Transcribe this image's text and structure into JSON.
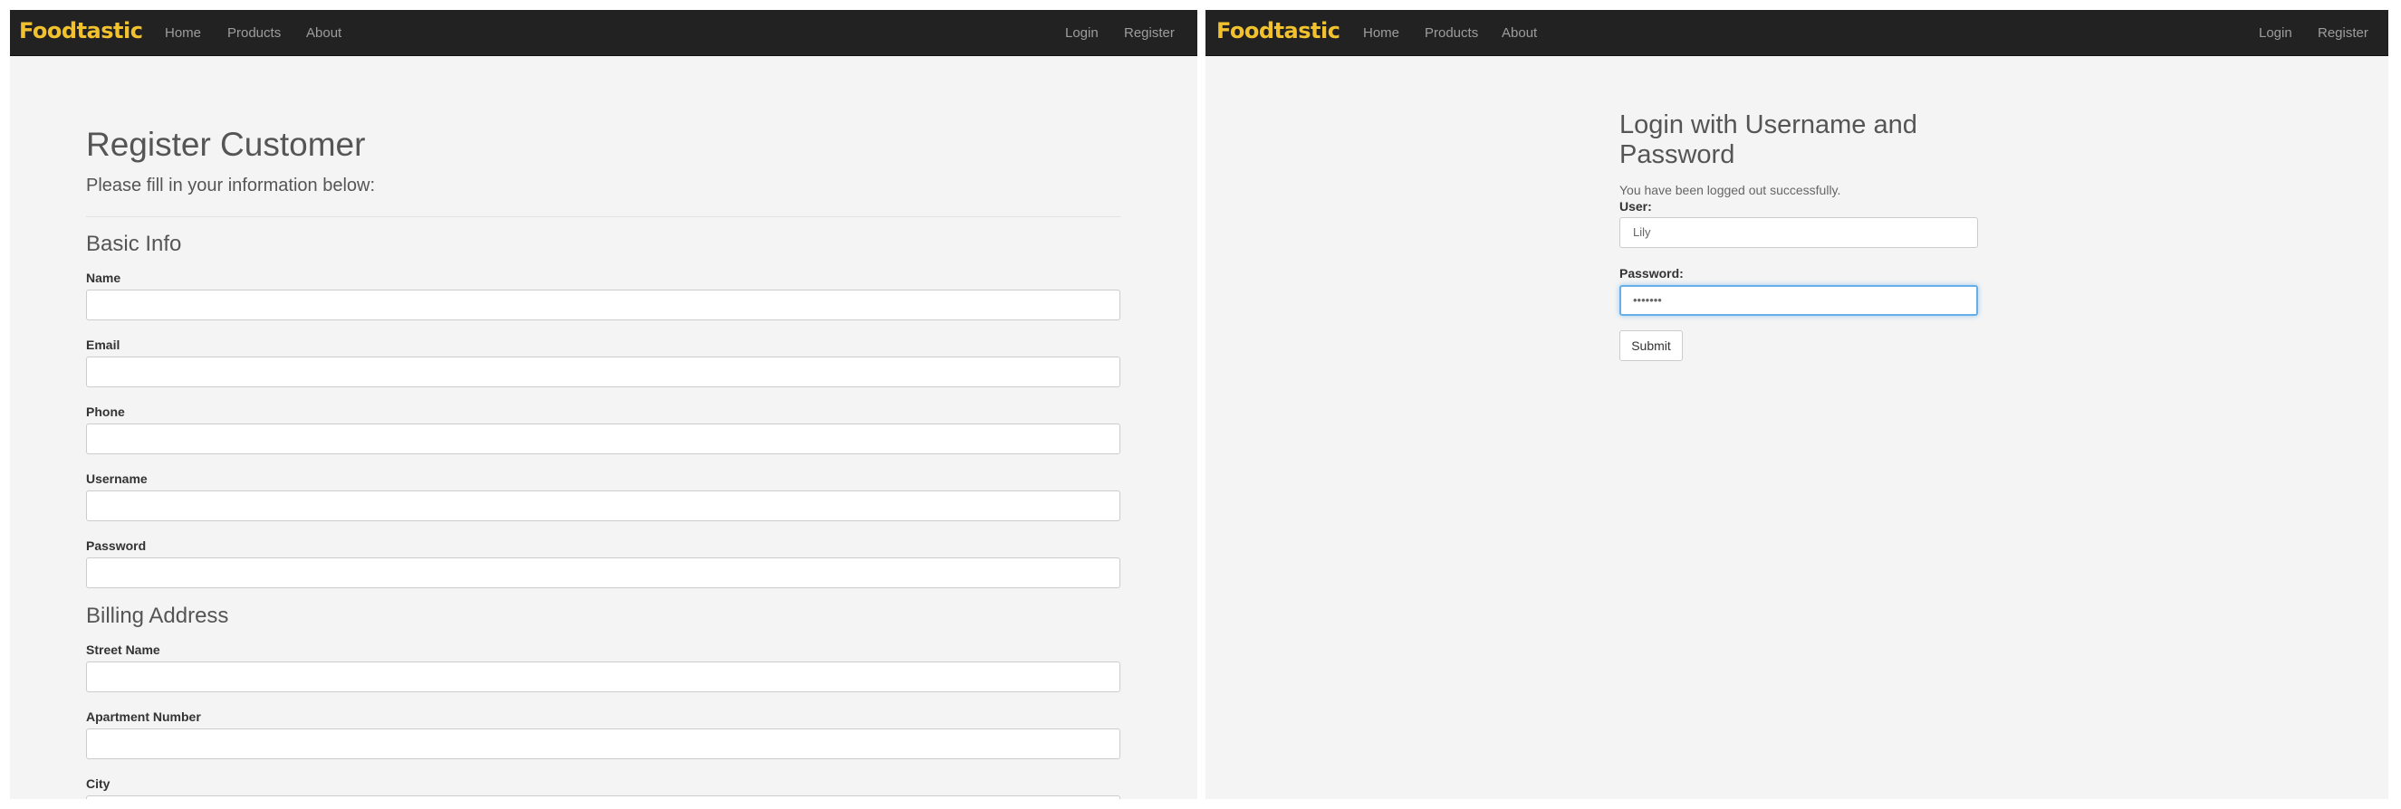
{
  "brand": {
    "name": "Foodtastic",
    "color": "#f2c12e"
  },
  "nav": {
    "left": [
      "Home",
      "Products",
      "About"
    ],
    "right": [
      "Login",
      "Register"
    ]
  },
  "register": {
    "title": "Register Customer",
    "subtitle": "Please fill in your information below:",
    "basic_info": {
      "heading": "Basic Info",
      "fields": [
        "Name",
        "Email",
        "Phone",
        "Username",
        "Password"
      ]
    },
    "billing": {
      "heading": "Billing Address",
      "fields": [
        "Street Name",
        "Apartment Number",
        "City"
      ]
    }
  },
  "login": {
    "title": "Login with Username and Password",
    "message": "You have been logged out successfully.",
    "user_label": "User:",
    "user_value": "Lily",
    "password_label": "Password:",
    "password_value": "•••••••",
    "submit": "Submit"
  }
}
